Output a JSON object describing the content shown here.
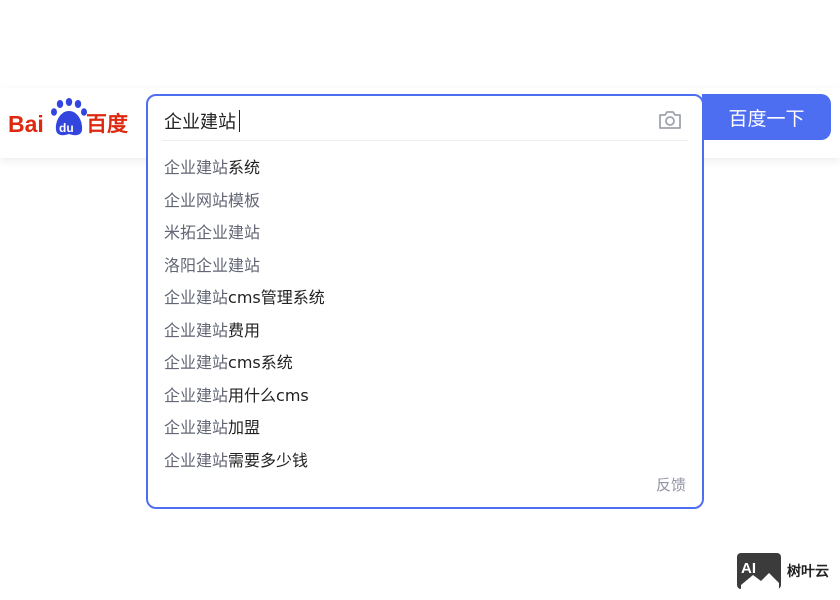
{
  "logo": {
    "text": "Bai百度"
  },
  "search": {
    "query": "企业建站",
    "camera_icon": "camera-icon",
    "button_label": "百度一下",
    "accent_color": "#4e6ef2",
    "suggestions": [
      {
        "prefix": "企业建站",
        "rest": "系统"
      },
      {
        "prefix": "企业网站模板",
        "rest": ""
      },
      {
        "prefix": "米拓企业建站",
        "rest": ""
      },
      {
        "prefix": "洛阳企业建站",
        "rest": ""
      },
      {
        "prefix": "企业建站",
        "rest": "cms管理系统"
      },
      {
        "prefix": "企业建站",
        "rest": "费用"
      },
      {
        "prefix": "企业建站",
        "rest": "cms系统"
      },
      {
        "prefix": "企业建站",
        "rest": "用什么cms"
      },
      {
        "prefix": "企业建站",
        "rest": "加盟"
      },
      {
        "prefix": "企业建站",
        "rest": "需要多少钱"
      }
    ],
    "feedback_label": "反馈"
  },
  "watermark": {
    "text": "树叶云"
  }
}
